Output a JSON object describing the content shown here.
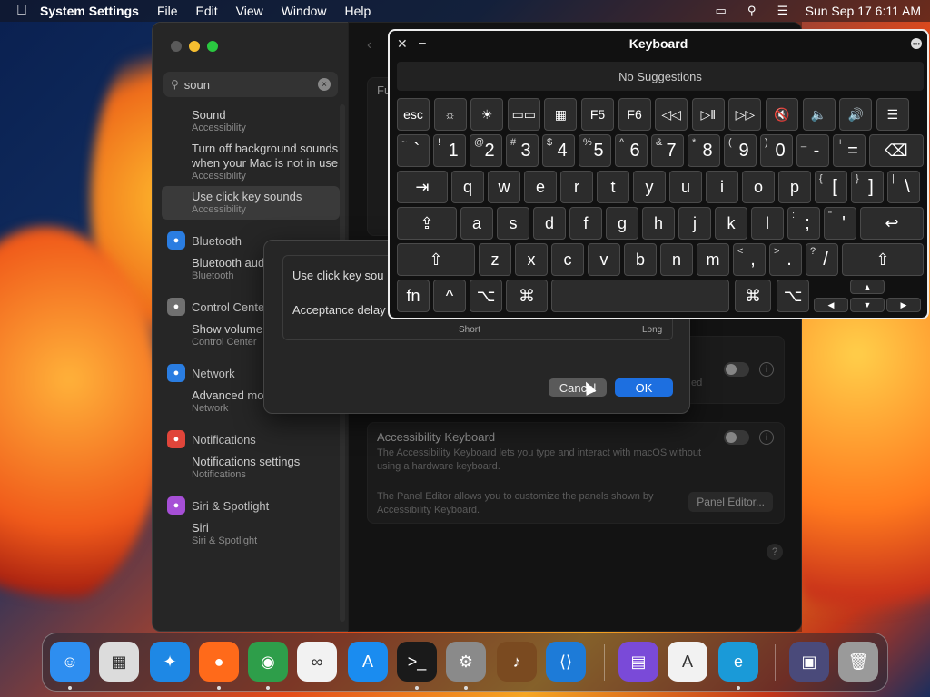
{
  "menubar": {
    "app": "System Settings",
    "items": [
      "File",
      "Edit",
      "View",
      "Window",
      "Help"
    ],
    "clock": "Sun Sep 17  6:11 AM"
  },
  "settings": {
    "search_value": "soun",
    "sidebar": [
      {
        "type": "item",
        "title": "Sound",
        "sub": "Accessibility"
      },
      {
        "type": "item",
        "title": "Turn off background sounds when your Mac is not in use",
        "sub": "Accessibility"
      },
      {
        "type": "item",
        "title": "Use click key sounds",
        "sub": "Accessibility",
        "selected": true
      },
      {
        "type": "cat",
        "title": "Bluetooth",
        "color": "#2a7de1",
        "icon": "bluetooth-icon"
      },
      {
        "type": "item",
        "title": "Bluetooth audio",
        "sub": "Bluetooth"
      },
      {
        "type": "cat",
        "title": "Control Center",
        "color": "#707070",
        "icon": "control-center-icon"
      },
      {
        "type": "item",
        "title": "Show volume in menu bar",
        "sub": "Control Center"
      },
      {
        "type": "cat",
        "title": "Network",
        "color": "#2a7de1",
        "icon": "network-icon"
      },
      {
        "type": "item",
        "title": "Advanced modem options",
        "sub": "Network"
      },
      {
        "type": "cat",
        "title": "Notifications",
        "color": "#e0453a",
        "icon": "notifications-icon"
      },
      {
        "type": "item",
        "title": "Notifications settings",
        "sub": "Notifications"
      },
      {
        "type": "cat",
        "title": "Siri & Spotlight",
        "color": "#a64fd6",
        "icon": "siri-icon"
      },
      {
        "type": "item",
        "title": "Siri",
        "sub": "Siri & Spotlight"
      }
    ],
    "content": {
      "hidden_header": "Fu",
      "accessibility_keyboard": {
        "title": "Accessibility Keyboard",
        "desc": "The Accessibility Keyboard lets you type and interact with macOS without using a hardware keyboard.",
        "panel_desc": "The Panel Editor allows you to customize the panels shown by Accessibility Keyboard.",
        "panel_button": "Panel Editor..."
      },
      "partial_text": "ed"
    }
  },
  "sheet": {
    "row1": "Use click key sou",
    "row2": "Acceptance delay",
    "short": "Short",
    "long": "Long",
    "cancel": "Cancel",
    "ok": "OK"
  },
  "keyboard": {
    "title": "Keyboard",
    "suggestions": "No Suggestions",
    "fn_row": [
      "esc",
      "☼",
      "☀",
      "▭▭",
      "▦",
      "F5",
      "F6",
      "◁◁",
      "▷‖",
      "▷▷",
      "🔇",
      "🔈",
      "🔊",
      "☰"
    ],
    "num_row": [
      [
        "~",
        "`"
      ],
      [
        "!",
        "1"
      ],
      [
        "@",
        "2"
      ],
      [
        "#",
        "3"
      ],
      [
        "$",
        "4"
      ],
      [
        "%",
        "5"
      ],
      [
        "^",
        "6"
      ],
      [
        "&",
        "7"
      ],
      [
        "*",
        "8"
      ],
      [
        "(",
        "9"
      ],
      [
        ")",
        "0"
      ],
      [
        "_",
        "-"
      ],
      [
        "+",
        "="
      ]
    ],
    "delete": "⌫",
    "tab": "⇥",
    "q_row": [
      "q",
      "w",
      "e",
      "r",
      "t",
      "y",
      "u",
      "i",
      "o",
      "p"
    ],
    "q_row_sym": [
      [
        "{",
        "["
      ],
      [
        "}",
        "]"
      ],
      [
        "|",
        "\\"
      ]
    ],
    "caps": "⇪",
    "a_row": [
      "a",
      "s",
      "d",
      "f",
      "g",
      "h",
      "j",
      "k",
      "l"
    ],
    "a_row_sym": [
      [
        ":",
        ";"
      ],
      [
        "\"",
        "'"
      ]
    ],
    "return": "↩",
    "shift": "⇧",
    "z_row": [
      "z",
      "x",
      "c",
      "v",
      "b",
      "n",
      "m"
    ],
    "z_row_sym": [
      [
        "<",
        ","
      ],
      [
        ">",
        "."
      ],
      [
        "?",
        "/"
      ]
    ],
    "bottom": {
      "fn": "fn",
      "ctrl": "^",
      "opt": "⌥",
      "cmd": "⌘"
    },
    "arrows": {
      "up": "▲",
      "down": "▼",
      "left": "◀",
      "right": "▶"
    }
  },
  "dock": {
    "apps": [
      {
        "name": "finder-icon",
        "glyph": "☺",
        "color": "#2e8ef0",
        "dot": true
      },
      {
        "name": "launchpad-icon",
        "glyph": "▦",
        "color": "#dcdcdc",
        "dot": false
      },
      {
        "name": "safari-icon",
        "glyph": "✦",
        "color": "#1e88e5",
        "dot": false
      },
      {
        "name": "firefox-icon",
        "glyph": "●",
        "color": "#ff6a1a",
        "dot": true
      },
      {
        "name": "chrome-icon",
        "glyph": "◉",
        "color": "#2e9e4a",
        "dot": true
      },
      {
        "name": "loop-icon",
        "glyph": "∞",
        "color": "#f2f2f2",
        "dot": false
      },
      {
        "name": "app-store-icon",
        "glyph": "A",
        "color": "#1a8cf0",
        "dot": false
      },
      {
        "name": "terminal-icon",
        "glyph": ">_",
        "color": "#1a1a1a",
        "dot": true
      },
      {
        "name": "system-settings-icon",
        "glyph": "⚙",
        "color": "#8a8a8a",
        "dot": true
      },
      {
        "name": "guitar-icon",
        "glyph": "♪",
        "color": "#7a4a20",
        "dot": false
      },
      {
        "name": "vscode-icon",
        "glyph": "⟨⟩",
        "color": "#1d7bd8",
        "dot": false
      },
      {
        "name": "storage-icon",
        "glyph": "▤",
        "color": "#7a4ad8",
        "dot": false
      },
      {
        "name": "instruments-icon",
        "glyph": "A",
        "color": "#f2f2f2",
        "dot": false
      },
      {
        "name": "edge-icon",
        "glyph": "e",
        "color": "#1a9ad8",
        "dot": true
      },
      {
        "name": "screenshot-icon",
        "glyph": "▣",
        "color": "#4a4a7a",
        "dot": false
      },
      {
        "name": "trash-icon",
        "glyph": "🗑",
        "color": "#9a9a9a",
        "dot": false
      }
    ]
  }
}
